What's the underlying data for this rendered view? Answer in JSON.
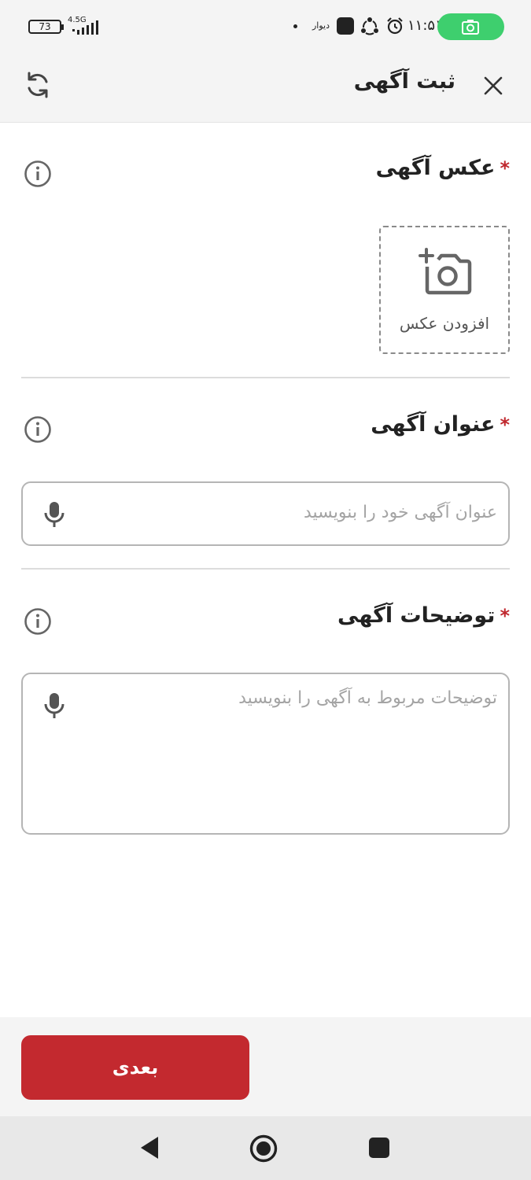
{
  "status_bar": {
    "battery": "73",
    "network": "4.5G",
    "app_name": "دیوار",
    "time": "۱۱:۵۱"
  },
  "toolbar": {
    "title": "ثبت آگهی",
    "close_icon": "close-icon",
    "refresh_icon": "refresh-icon"
  },
  "photo_section": {
    "title": "عکس آگهی",
    "required_mark": "*",
    "add_photo_label": "افزودن عکس"
  },
  "title_section": {
    "title": "عنوان آگهی",
    "required_mark": "*",
    "placeholder": "عنوان آگهی خود را بنویسید"
  },
  "description_section": {
    "title": "توضیحات آگهی",
    "required_mark": "*",
    "placeholder": "توضیحات مربوط به آگهی را بنویسید"
  },
  "footer": {
    "next_label": "بعدی"
  },
  "colors": {
    "accent": "#c3292f",
    "screen_record_pill": "#3ecf6e"
  }
}
